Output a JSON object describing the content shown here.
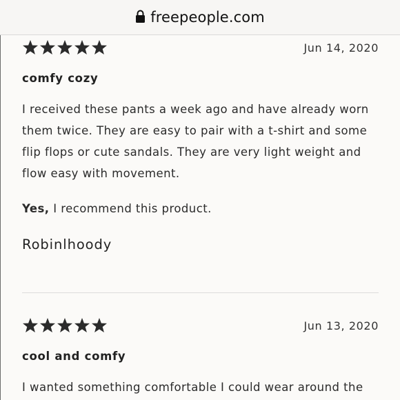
{
  "browser": {
    "url": "freepeople.com",
    "lock_icon": "lock-icon"
  },
  "reviews": [
    {
      "rating": 5,
      "max_rating": 5,
      "date": "Jun 14, 2020",
      "title": "comfy cozy",
      "body": "I received these pants a week ago and have already worn them twice. They are easy to pair with a t-shirt and some flip flops or cute sandals. They are very light weight and flow easy with movement.",
      "recommend_yes": "Yes,",
      "recommend_text": " I recommend this product.",
      "author": "Robinlhoody"
    },
    {
      "rating": 5,
      "max_rating": 5,
      "date": "Jun 13, 2020",
      "title": "cool and comfy",
      "body": "I wanted something comfortable I could wear around the"
    }
  ],
  "colors": {
    "star": "#2b2b2b",
    "background": "#fbfaf8",
    "text": "#2b2b2b"
  }
}
